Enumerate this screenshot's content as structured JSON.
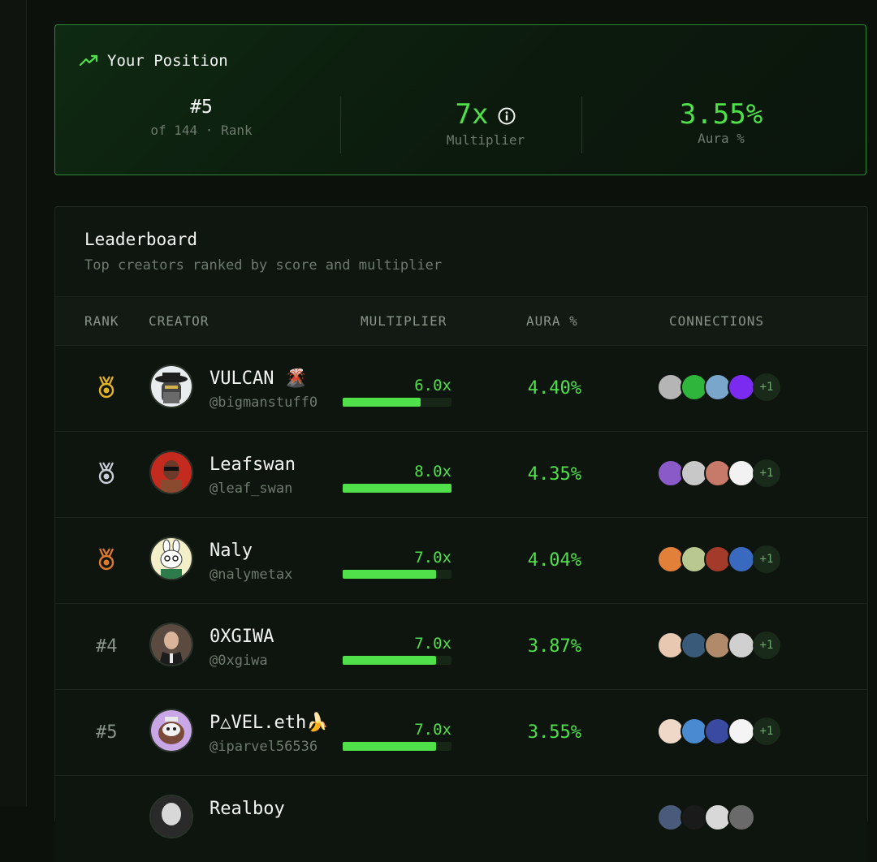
{
  "position": {
    "title": "Your Position",
    "rank": "#5",
    "rank_sub": "of 144 · Rank",
    "multiplier": "7x",
    "multiplier_label": "Multiplier",
    "aura": "3.55%",
    "aura_label": "Aura %"
  },
  "leaderboard": {
    "title": "Leaderboard",
    "subtitle": "Top creators ranked by score and multiplier",
    "columns": {
      "rank": "RANK",
      "creator": "CREATOR",
      "multiplier": "MULTIPLIER",
      "aura": "AURA %",
      "connections": "CONNECTIONS"
    },
    "rows": [
      {
        "rank": "",
        "medal": "gold-medal-icon",
        "name": "VULCAN 🌋",
        "handle": "@bigmanstuff0",
        "multiplier": "6.0x",
        "multiplier_level": 0.72,
        "aura": "4.40%",
        "connections_more": "+1"
      },
      {
        "rank": "",
        "medal": "silver-medal-icon",
        "name": "Leafswan",
        "handle": "@leaf_swan",
        "multiplier": "8.0x",
        "multiplier_level": 1.0,
        "aura": "4.35%",
        "connections_more": "+1"
      },
      {
        "rank": "",
        "medal": "bronze-medal-icon",
        "name": "Naly",
        "handle": "@nalymetax",
        "multiplier": "7.0x",
        "multiplier_level": 0.86,
        "aura": "4.04%",
        "connections_more": "+1"
      },
      {
        "rank": "#4",
        "medal": "",
        "name": "0XGIWA",
        "handle": "@0xgiwa",
        "multiplier": "7.0x",
        "multiplier_level": 0.86,
        "aura": "3.87%",
        "connections_more": "+1"
      },
      {
        "rank": "#5",
        "medal": "",
        "name": "P△VEL.eth🍌",
        "handle": "@iparvel56536",
        "multiplier": "7.0x",
        "multiplier_level": 0.86,
        "aura": "3.55%",
        "connections_more": "+1"
      },
      {
        "rank": "",
        "medal": "",
        "name": "Realboy",
        "handle": "",
        "multiplier": "",
        "multiplier_level": 0,
        "aura": "",
        "connections_more": ""
      }
    ]
  },
  "colors": {
    "accent": "#4fe04a",
    "gold": "#e6b422",
    "silver": "#c9ced6",
    "bronze": "#e07a2a"
  }
}
